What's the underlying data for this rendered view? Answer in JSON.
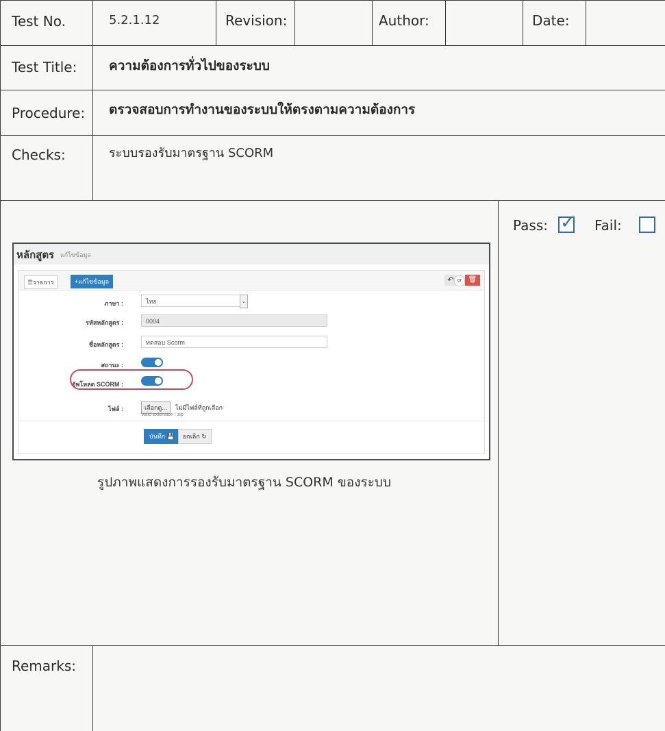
{
  "header": {
    "test_no_label": "Test No.",
    "test_no_value": "5.2.1.12",
    "revision_label": "Revision:",
    "revision_value": "",
    "author_label": "Author:",
    "author_value": "",
    "date_label": "Date:",
    "date_value": ""
  },
  "test_title": {
    "label": "Test Title:",
    "value": "ความต้องการทั่วไปของระบบ"
  },
  "procedure": {
    "label": "Procedure:",
    "value": "ตรวจสอบการทำงานของระบบให้ตรงตามความต้องการ"
  },
  "checks": {
    "label": "Checks:",
    "value": "ระบบรองรับมาตรฐาน SCORM"
  },
  "result": {
    "pass_label": "Pass:",
    "pass_checked": true,
    "pass_mark": "✓",
    "fail_label": "Fail:",
    "fail_checked": false
  },
  "screenshot": {
    "title": "หลักสูตร",
    "subtitle": "แก้ไขข้อมูล",
    "list_button": "☰รายการ",
    "edit_button": "+แก้ไขข้อมูล",
    "undo_icon": "↶",
    "or_text": "or",
    "delete_icon": "🗑",
    "fields": {
      "language_label": "ภาษา :",
      "language_value": "ไทย",
      "code_label": "รหัสหลักสูตร :",
      "code_value": "0004",
      "name_label": "ชื่อหลักสูตร :",
      "name_value": "ทดสอบ Scorm",
      "status_label": "สถานะ :",
      "scorm_label": "อัพโหลด SCORM :",
      "file_label": "ไฟล์ :",
      "file_button": "เลือกดู...",
      "file_text": "ไม่มีไฟล์ที่ถูกเลือก",
      "file_hint": "Valid extension : zip"
    },
    "save_button": "บันทึก 💾",
    "cancel_button": "ยกเลิก ↻"
  },
  "caption": "รูปภาพแสดงการรองรับมาตรฐาน SCORM ของระบบ",
  "remarks": {
    "label": "Remarks:",
    "value": ""
  }
}
